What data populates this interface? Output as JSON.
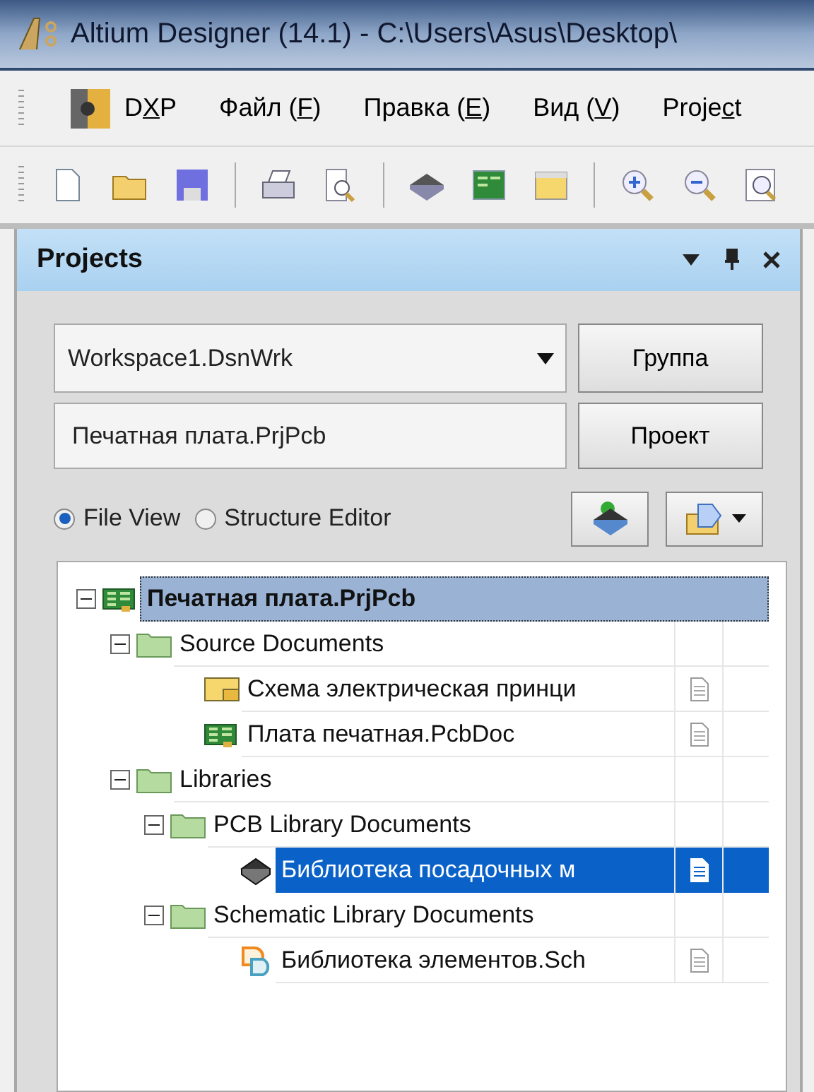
{
  "window": {
    "title": "Altium Designer (14.1) - C:\\Users\\Asus\\Desktop\\"
  },
  "menu": [
    {
      "before": "D",
      "key": "X",
      "after": "P"
    },
    {
      "before": "Файл (",
      "key": "F",
      "after": ")"
    },
    {
      "before": "Правка (",
      "key": "E",
      "after": ")"
    },
    {
      "before": "Вид (",
      "key": "V",
      "after": ")"
    },
    {
      "before": "Proje",
      "key": "c",
      "after": "t"
    }
  ],
  "panel": {
    "title": "Projects",
    "workspace": {
      "value": "Workspace1.DsnWrk"
    },
    "workspace_button": "Группа",
    "project": {
      "value": "Печатная плата.PrjPcb"
    },
    "project_button": "Проект",
    "views": [
      {
        "label": "File View",
        "selected": true
      },
      {
        "label": "Structure Editor",
        "selected": false
      }
    ],
    "tree": [
      {
        "kind": "project",
        "label": "Печатная плата.PrjPcb",
        "expanded": true,
        "focused": true,
        "selected": false,
        "children": [
          {
            "kind": "folder",
            "label": "Source Documents",
            "expanded": true,
            "focused": false,
            "selected": false,
            "children": [
              {
                "kind": "schdoc",
                "label": "Схема электрическая принци",
                "focused": false,
                "selected": false
              },
              {
                "kind": "pcbdoc",
                "label": "Плата печатная.PcbDoc",
                "focused": false,
                "selected": false
              }
            ]
          },
          {
            "kind": "folder",
            "label": "Libraries",
            "expanded": true,
            "focused": false,
            "selected": false,
            "children": [
              {
                "kind": "folder",
                "label": "PCB Library Documents",
                "expanded": true,
                "focused": false,
                "selected": false,
                "children": [
                  {
                    "kind": "pcblib",
                    "label": "Библиотека посадочных м",
                    "focused": false,
                    "selected": true
                  }
                ]
              },
              {
                "kind": "folder",
                "label": "Schematic Library Documents",
                "expanded": true,
                "focused": false,
                "selected": false,
                "children": [
                  {
                    "kind": "schlib",
                    "label": "Библиотека элементов.Sch",
                    "focused": false,
                    "selected": false
                  }
                ]
              }
            ]
          }
        ]
      }
    ]
  }
}
